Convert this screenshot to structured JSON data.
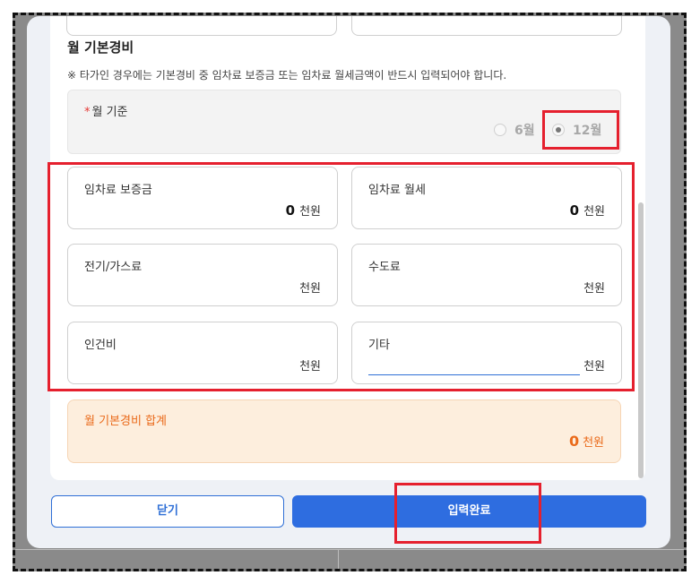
{
  "section": {
    "title": "월 기본경비",
    "notice": "※ 타가인 경우에는 기본경비 중 임차료 보증금 또는 임차료 월세금액이 반드시 입력되어야 합니다."
  },
  "monthly_basis": {
    "required_mark": "*",
    "label": "월 기준",
    "options": [
      {
        "label": "6월",
        "selected": false
      },
      {
        "label": "12월",
        "selected": true
      }
    ]
  },
  "fields": [
    {
      "label": "임차료 보증금",
      "value": "0",
      "unit": "천원"
    },
    {
      "label": "임차료 월세",
      "value": "0",
      "unit": "천원"
    },
    {
      "label": "전기/가스료",
      "value": "",
      "unit": "천원"
    },
    {
      "label": "수도료",
      "value": "",
      "unit": "천원"
    },
    {
      "label": "인건비",
      "value": "",
      "unit": "천원"
    },
    {
      "label": "기타",
      "value": "",
      "unit": "천원"
    }
  ],
  "total": {
    "label": "월 기본경비 합계",
    "value": "0",
    "unit": "천원"
  },
  "buttons": {
    "close": "닫기",
    "submit": "입력완료"
  },
  "colors": {
    "highlight": "#e5202e",
    "primary": "#2e6de0",
    "total_accent": "#ea6a1a"
  }
}
